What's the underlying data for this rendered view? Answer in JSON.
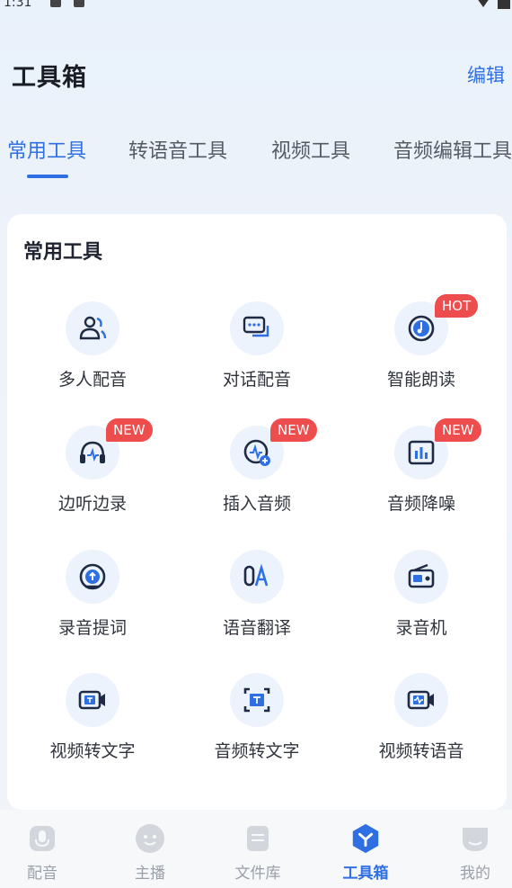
{
  "status_bar": {
    "time": "1:31"
  },
  "header": {
    "title": "工具箱",
    "edit_label": "编辑"
  },
  "tabs": [
    {
      "label": "常用工具",
      "active": true
    },
    {
      "label": "转语音工具",
      "active": false
    },
    {
      "label": "视频工具",
      "active": false
    },
    {
      "label": "音频编辑工具",
      "active": false
    }
  ],
  "section": {
    "title": "常用工具",
    "tools": [
      {
        "label": "多人配音",
        "icon": "people-icon",
        "badge": ""
      },
      {
        "label": "对话配音",
        "icon": "chat-icon",
        "badge": ""
      },
      {
        "label": "智能朗读",
        "icon": "music-disc-icon",
        "badge": "HOT"
      },
      {
        "label": "边听边录",
        "icon": "headphones-icon",
        "badge": "NEW"
      },
      {
        "label": "插入音频",
        "icon": "insert-audio-icon",
        "badge": "NEW"
      },
      {
        "label": "音频降噪",
        "icon": "noise-reduction-icon",
        "badge": "NEW"
      },
      {
        "label": "录音提词",
        "icon": "teleprompter-icon",
        "badge": ""
      },
      {
        "label": "语音翻译",
        "icon": "translate-icon",
        "badge": ""
      },
      {
        "label": "录音机",
        "icon": "radio-icon",
        "badge": ""
      },
      {
        "label": "视频转文字",
        "icon": "video-to-text-icon",
        "badge": ""
      },
      {
        "label": "音频转文字",
        "icon": "audio-to-text-icon",
        "badge": ""
      },
      {
        "label": "视频转语音",
        "icon": "video-to-voice-icon",
        "badge": ""
      }
    ]
  },
  "bottom_nav": [
    {
      "label": "配音",
      "icon": "mic-icon",
      "active": false
    },
    {
      "label": "主播",
      "icon": "anchor-face-icon",
      "active": false
    },
    {
      "label": "文件库",
      "icon": "file-icon",
      "active": false
    },
    {
      "label": "工具箱",
      "icon": "toolbox-icon",
      "active": true
    },
    {
      "label": "我的",
      "icon": "profile-icon",
      "active": false
    }
  ],
  "colors": {
    "accent": "#2f6fe4",
    "badge": "#ee4d4d",
    "icon_bg": "#edf3fc"
  }
}
